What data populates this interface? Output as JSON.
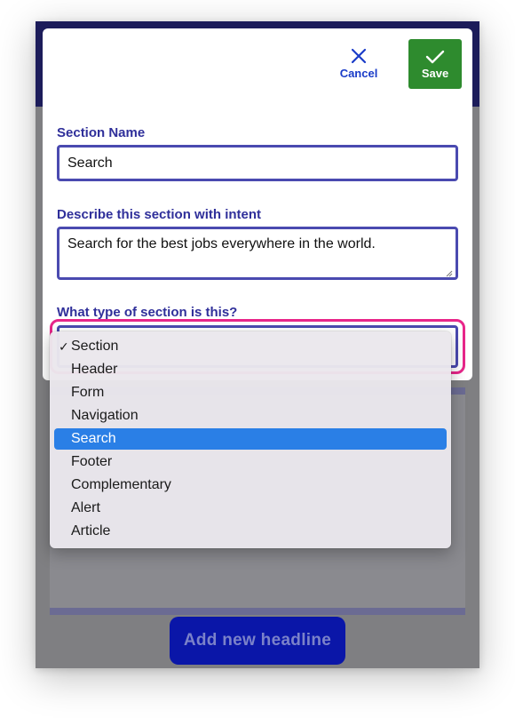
{
  "background": {
    "add_button_label": "Add new headline"
  },
  "modal": {
    "cancel_label": "Cancel",
    "save_label": "Save",
    "section_name": {
      "label": "Section Name",
      "value": "Search"
    },
    "description": {
      "label": "Describe this section with intent",
      "value": "Search for the best jobs everywhere in the world."
    },
    "section_type": {
      "label": "What type of section is this?"
    }
  },
  "dropdown": {
    "checked_option": "Section",
    "highlighted_option": "Search",
    "options": [
      "Section",
      "Header",
      "Form",
      "Navigation",
      "Search",
      "Footer",
      "Complementary",
      "Alert",
      "Article"
    ]
  },
  "colors": {
    "primary": "#2f2f9a",
    "save_green": "#2e8b2e",
    "focus_pink": "#e8268a",
    "highlight_blue": "#2a7fe6"
  },
  "icons": {
    "cancel": "close-icon",
    "save": "checkmark-icon",
    "checked": "check-icon"
  }
}
